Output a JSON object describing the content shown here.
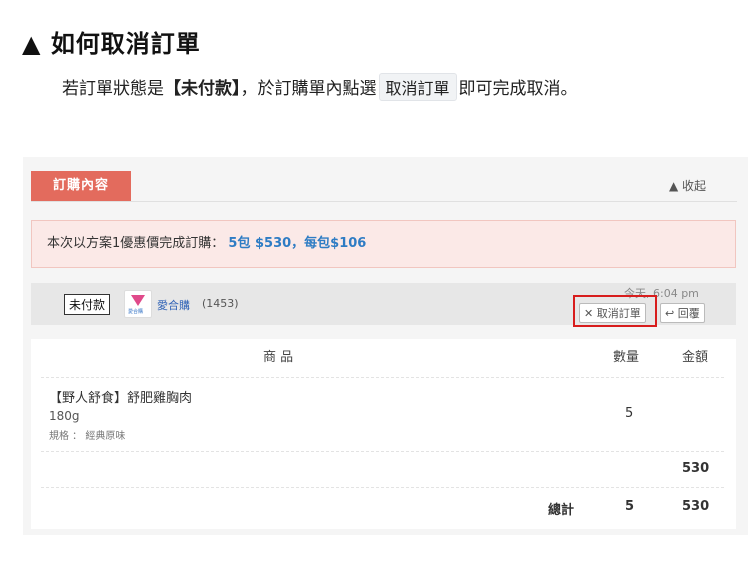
{
  "heading": "▲ 如何取消訂單",
  "description": {
    "pre": "若訂單狀態是",
    "status_bracket": "【未付款】",
    "mid": "，於訂購單內點選",
    "inline_button": "取消訂單",
    "post": "即可完成取消。"
  },
  "panel": {
    "tab_label": "訂購內容",
    "collapse_label": "▲ 收起",
    "notice": {
      "text": "本次以方案1優惠價完成訂購：",
      "highlight": "5包 $530，每包$106"
    },
    "order": {
      "status": "未付款",
      "shop_logo_text": "愛合購",
      "shop_name": "愛合購",
      "shop_count": "(1453)",
      "time": "今天, 6:04 pm",
      "cancel_button": "✕ 取消訂單",
      "reply_button": "↩ 回覆"
    },
    "table": {
      "headers": {
        "product": "商 品",
        "qty": "數量",
        "amount": "金額"
      },
      "item": {
        "name": "【野人舒食】舒肥雞胸肉",
        "weight": "180g",
        "spec": "規格 ： 經典原味",
        "qty": "5"
      },
      "subtotal_amount": "530",
      "total": {
        "label": "總計",
        "qty": "5",
        "amount": "530"
      }
    }
  },
  "colors": {
    "accent": "#e36b5d",
    "link": "#2e7cc4",
    "highlight_border": "#d81d1d"
  }
}
